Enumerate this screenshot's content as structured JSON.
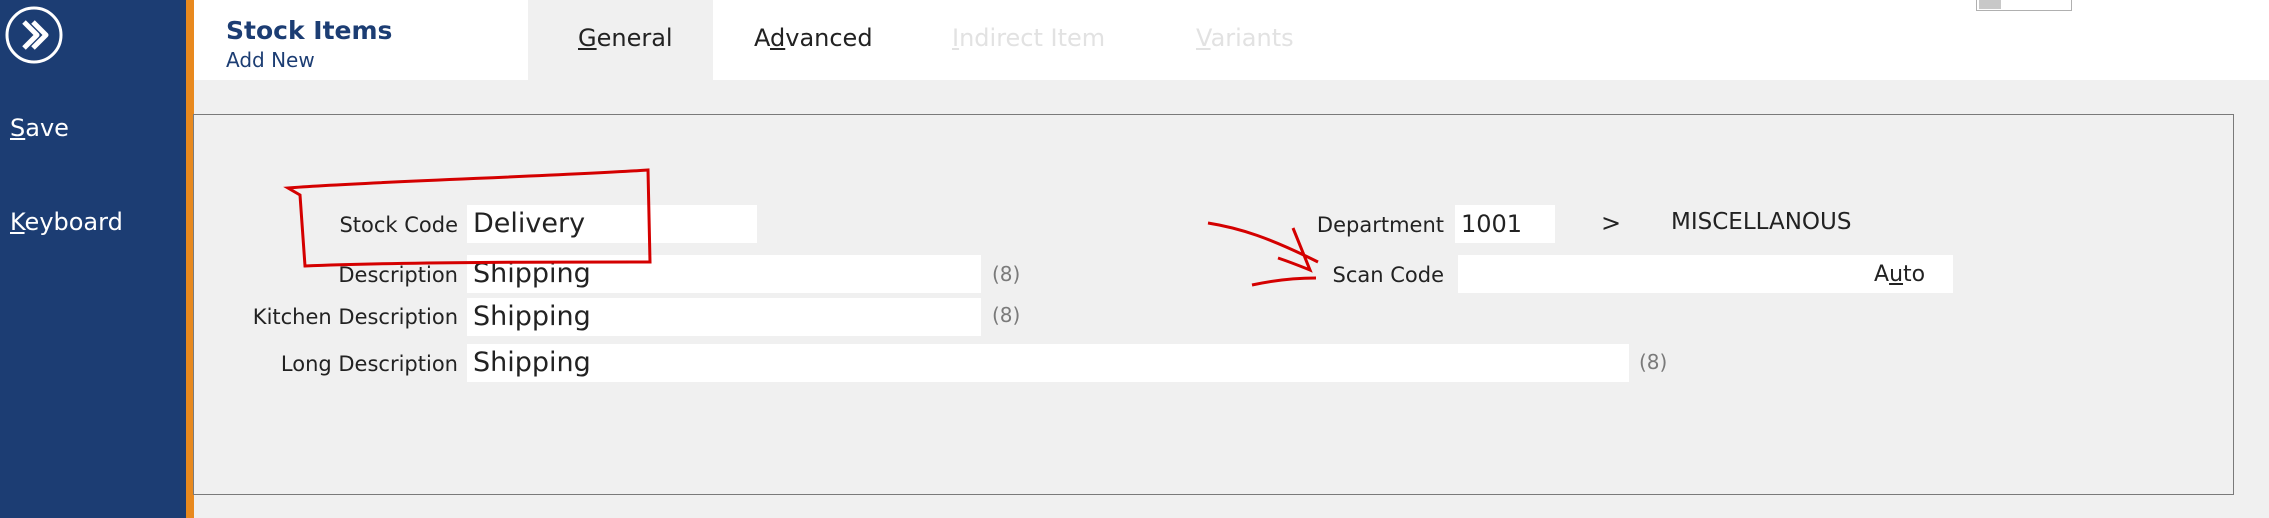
{
  "sidebar": {
    "items": [
      {
        "prefix": "",
        "mnemonic": "S",
        "rest": "ave"
      },
      {
        "prefix": "",
        "mnemonic": "K",
        "rest": "eyboard"
      }
    ]
  },
  "header": {
    "title": "Stock Items",
    "subtitle": "Add New",
    "tabs": [
      {
        "prefix": "",
        "mnemonic": "G",
        "rest": "eneral",
        "state": "active"
      },
      {
        "prefix": "A",
        "mnemonic": "d",
        "rest": "vanced",
        "state": "enabled"
      },
      {
        "prefix": "",
        "mnemonic": "I",
        "rest": "ndirect Item",
        "state": "disabled"
      },
      {
        "prefix": "",
        "mnemonic": "V",
        "rest": "ariants",
        "state": "disabled"
      }
    ]
  },
  "form": {
    "stock_code": {
      "label": "Stock Code",
      "value": "Delivery"
    },
    "description": {
      "label": "Description",
      "value": "Shipping",
      "hint": "(8)"
    },
    "kitchen_description": {
      "label": "Kitchen Description",
      "value": "Shipping",
      "hint": "(8)"
    },
    "long_description": {
      "label": "Long Description",
      "value": "Shipping",
      "hint": "(8)"
    },
    "department": {
      "label": "Department",
      "code": "1001",
      "arrow": ">",
      "name": "MISCELLANOUS"
    },
    "scan_code": {
      "label": "Scan Code",
      "value": "",
      "auto_prefix": "A",
      "auto_mnemonic": "u",
      "auto_rest": "to"
    }
  },
  "colors": {
    "sidebar": "#1c3d73",
    "accent": "#e8891e",
    "annotation": "#d40000"
  },
  "icons": {
    "logo": "forward-chevron-circle-icon"
  }
}
